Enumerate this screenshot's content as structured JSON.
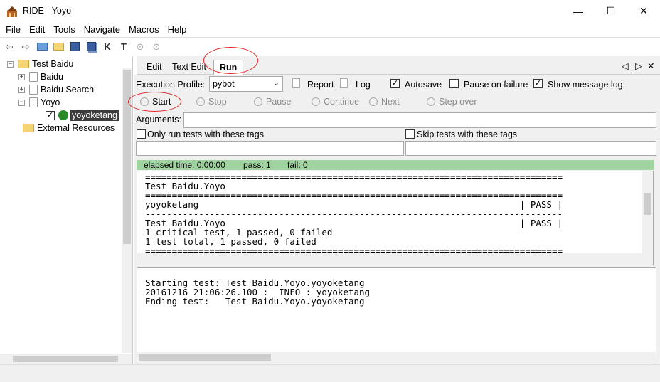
{
  "window": {
    "title": "RIDE - Yoyo",
    "minimize": "—",
    "maximize": "☐",
    "close": "✕"
  },
  "menu": [
    "File",
    "Edit",
    "Tools",
    "Navigate",
    "Macros",
    "Help"
  ],
  "tree": {
    "root": "Test Baidu",
    "children": [
      "Baidu",
      "Baidu Search",
      "Yoyo"
    ],
    "testcase": "yoyoketang",
    "external": "External Resources"
  },
  "tabs": [
    "Edit",
    "Text Edit",
    "Run"
  ],
  "tab_nav": {
    "left": "◁",
    "right": "▷",
    "close": "✕"
  },
  "run": {
    "execution_profile_label": "Execution Profile:",
    "profile_value": "pybot",
    "report_label": "Report",
    "log_label": "Log",
    "autosave_label": "Autosave",
    "autosave_checked": "✓",
    "pause_on_failure_label": "Pause on failure",
    "show_message_log_label": "Show message log",
    "show_message_log_checked": "✓",
    "start_label": "Start",
    "stop_label": "Stop",
    "pause_label": "Pause",
    "continue_label": "Continue",
    "next_label": "Next",
    "step_over_label": "Step over",
    "arguments_label": "Arguments:",
    "only_run_tags_label": "Only run tests with these tags",
    "skip_tags_label": "Skip tests with these tags",
    "elapsed_time": "elapsed time: 0:00:00",
    "pass_count": "pass: 1",
    "fail_count": "fail: 0"
  },
  "output_lines": [
    "==============================================================================",
    "Test Baidu.Yoyo",
    "==============================================================================",
    "yoyoketang                                                            | PASS |",
    "------------------------------------------------------------------------------",
    "Test Baidu.Yoyo                                                       | PASS |",
    "1 critical test, 1 passed, 0 failed",
    "1 test total, 1 passed, 0 failed",
    "=============================================================================="
  ],
  "message_log": [
    "Starting test: Test Baidu.Yoyo.yoyoketang",
    "20161216 21:06:26.100 :  INFO : yoyoketang",
    "Ending test:   Test Baidu.Yoyo.yoyoketang"
  ],
  "colors": {
    "progress_bar": "#9fd39f",
    "selection": "#3c3c3c",
    "annotation": "#e02020"
  }
}
